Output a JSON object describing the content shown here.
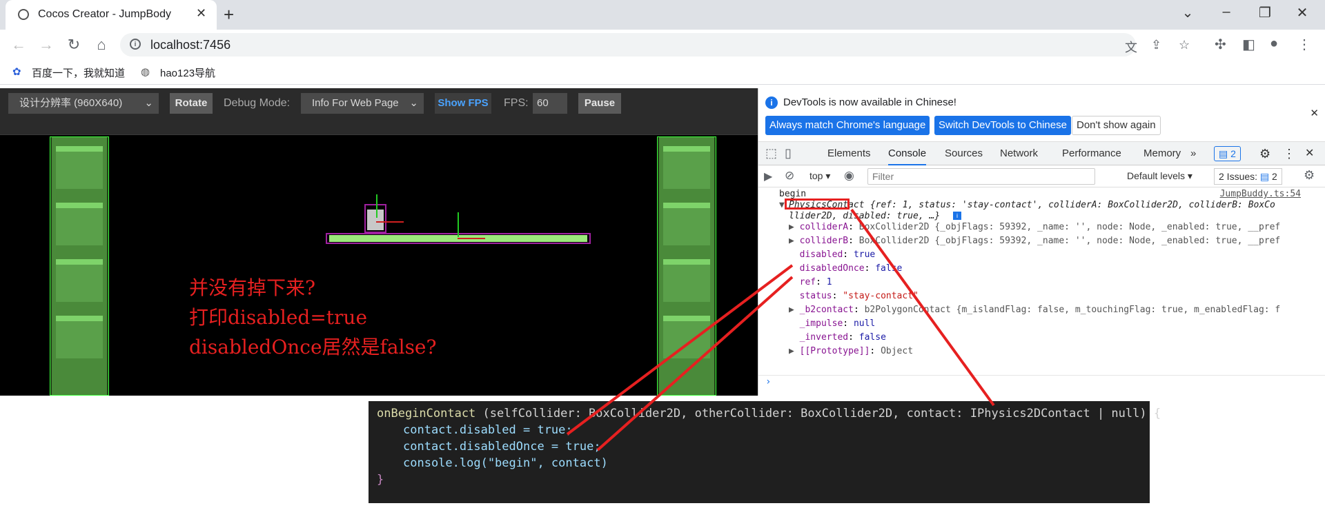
{
  "browser": {
    "tab_title": "Cocos Creator - JumpBody",
    "url": "localhost:7456",
    "bookmarks": [
      "百度一下，我就知道",
      "hao123导航"
    ]
  },
  "game_toolbar": {
    "resolution": "设计分辨率 (960X640)",
    "rotate": "Rotate",
    "debug_mode_label": "Debug Mode:",
    "debug_mode_value": "Info For Web Page",
    "show_fps": "Show FPS",
    "fps_label": "FPS:",
    "fps_value": "60",
    "pause": "Pause"
  },
  "annotation": {
    "line1": "并没有掉下来?",
    "line2": "打印disabled=true",
    "line3": "disabledOnce居然是false?"
  },
  "devtools": {
    "notice": "DevTools is now available in Chinese!",
    "btn_match": "Always match Chrome's language",
    "btn_switch": "Switch DevTools to Chinese",
    "btn_dont_show": "Don't show again",
    "tabs": [
      "Elements",
      "Console",
      "Sources",
      "Network",
      "Performance",
      "Memory"
    ],
    "issues_badge": "2",
    "context": "top",
    "filter_placeholder": "Filter",
    "levels": "Default levels",
    "issues_label": "2 Issues:",
    "issues_count": "2",
    "log_begin": "begin",
    "log_source": "JumpBuddy.ts:54",
    "obj_class": "PhysicsContact",
    "obj_preview_1": " {ref: 1, status: 'stay-contact', colliderA: BoxCollider2D, colliderB: BoxCo",
    "obj_preview_2": "llider2D, disabled: true, …}",
    "props": [
      {
        "key": "colliderA",
        "val": "BoxCollider2D {_objFlags: 59392, _name: '', node: Node, _enabled: true, __pref",
        "expand": true
      },
      {
        "key": "colliderB",
        "val": "BoxCollider2D {_objFlags: 59392, _name: '', node: Node, _enabled: true, __pref",
        "expand": true
      },
      {
        "key": "disabled",
        "val": "true",
        "expand": false
      },
      {
        "key": "disabledOnce",
        "val": "false",
        "expand": false
      },
      {
        "key": "ref",
        "val": "1",
        "expand": false
      },
      {
        "key": "status",
        "val": "\"stay-contact\"",
        "expand": false
      },
      {
        "key": "_b2contact",
        "val": "b2PolygonContact {m_islandFlag: false, m_touchingFlag: true, m_enabledFlag: f",
        "expand": true
      },
      {
        "key": "_impulse",
        "val": "null",
        "expand": false
      },
      {
        "key": "_inverted",
        "val": "false",
        "expand": false
      },
      {
        "key": "[[Prototype]]",
        "val": "Object",
        "expand": true
      }
    ]
  },
  "code": {
    "line1_fn": "onBeginContact",
    "line1_rest": " (selfCollider: BoxCollider2D, otherCollider: BoxCollider2D, contact: IPhysics2DContact | null) {",
    "line2": "contact.disabled = true;",
    "line3": "contact.disabledOnce = true;",
    "line4": "console.log(\"begin\", contact)",
    "line5": "}"
  },
  "colors": {
    "highlight_red": "#e62020",
    "devtools_blue": "#1a73e8",
    "platform_green": "#9be87a"
  }
}
